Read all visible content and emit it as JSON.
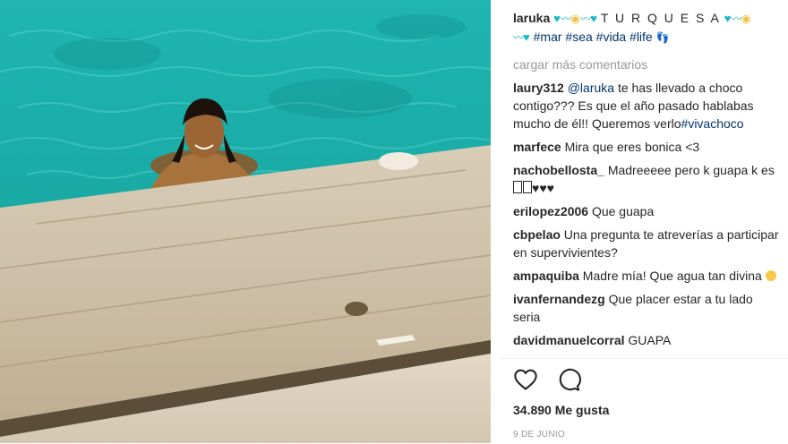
{
  "post": {
    "username": "laruka",
    "caption": {
      "title": "T U R Q U E S A",
      "hashtags": [
        "#mar",
        "#sea",
        "#vida",
        "#life"
      ],
      "footprints": "👣"
    },
    "load_more": "cargar más comentarios",
    "comments": [
      {
        "user": "laury312",
        "mention": "@laruka",
        "text_a": " te has llevado a choco contigo??? Es que el año pasado hablabas mucho de él!! Queremos verlo",
        "hashtag": "#vivachoco"
      },
      {
        "user": "marfece",
        "text": "Mira que eres bonica <3"
      },
      {
        "user": "nachobellosta_",
        "text": "Madreeeee pero k guapa k es",
        "suffix": "♥♥♥"
      },
      {
        "user": "erilopez2006",
        "text": "Que guapa"
      },
      {
        "user": "cbpelao",
        "text": "Una pregunta te atreverías a participar en supervivientes?"
      },
      {
        "user": "ampaquiba",
        "text": "Madre mía! Que agua tan divina"
      },
      {
        "user": "ivanfernandezg",
        "text": "Que placer estar a tu lado seria"
      },
      {
        "user": "davidmanuelcorral",
        "text": "GUAPA"
      }
    ],
    "likes": "34.890 Me gusta",
    "date": "9 DE JUNIO"
  },
  "icons": {
    "like": "heart-outline-icon",
    "comment": "speech-bubble-icon",
    "caption_hearts": "turquoise-heart-icon",
    "caption_shells": "shell-icon",
    "caption_waves": "wave-icon"
  },
  "colors": {
    "username": "#262626",
    "link": "#003569",
    "muted": "#999999",
    "water": "#1bb7c8"
  }
}
